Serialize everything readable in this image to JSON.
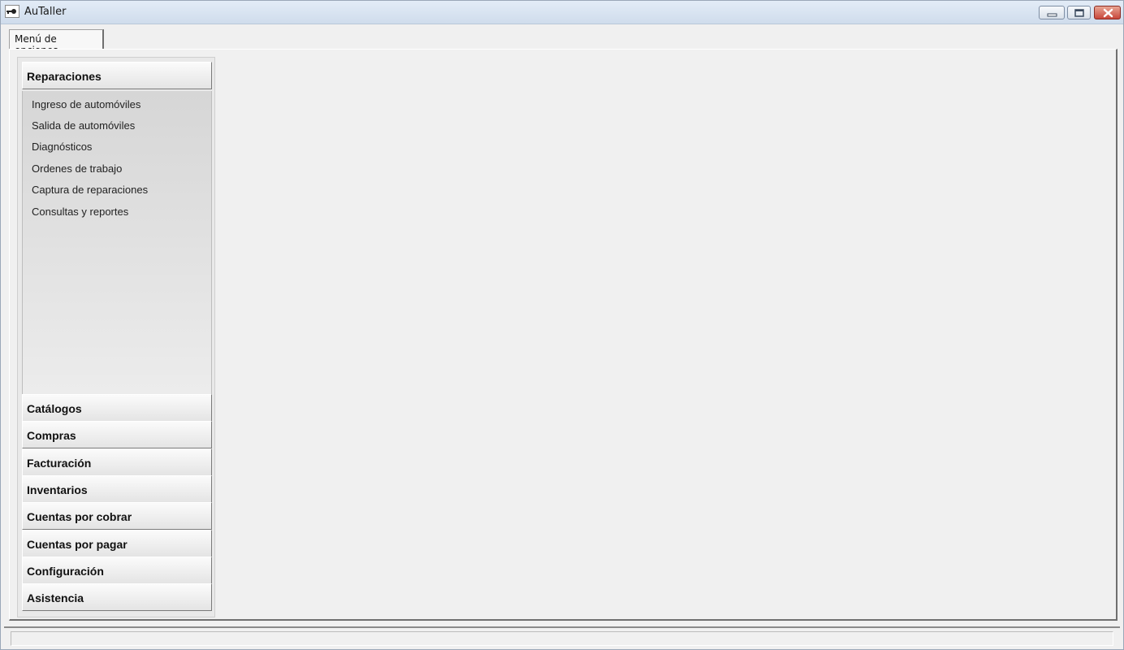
{
  "window": {
    "title": "AuTaller",
    "icon": "car-key-icon",
    "controls": [
      "minimize-icon",
      "maximize-icon",
      "close-icon"
    ]
  },
  "tabs": [
    {
      "label": "Menú de opciones",
      "active": true
    }
  ],
  "nav": {
    "expanded_group": {
      "label": "Reparaciones",
      "items": [
        {
          "label": "Ingreso de automóviles"
        },
        {
          "label": "Salida de automóviles"
        },
        {
          "label": "Diagnósticos"
        },
        {
          "label": "Ordenes de trabajo"
        },
        {
          "label": "Captura de reparaciones"
        },
        {
          "label": "Consultas y reportes"
        }
      ]
    },
    "groups": [
      {
        "label": "Catálogos"
      },
      {
        "label": "Compras"
      },
      {
        "label": "Facturación"
      },
      {
        "label": "Inventarios"
      },
      {
        "label": "Cuentas por cobrar"
      },
      {
        "label": "Cuentas por pagar"
      },
      {
        "label": "Configuración"
      },
      {
        "label": "Asistencia"
      }
    ]
  },
  "status": {
    "text": ""
  },
  "colors": {
    "titlebar": "#d6e2f0",
    "close_button": "#c9473b",
    "panel_bg": "#f0f0f0"
  }
}
